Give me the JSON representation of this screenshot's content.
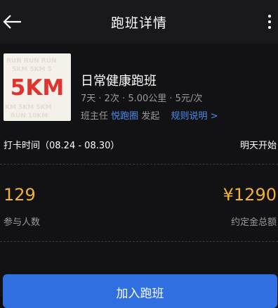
{
  "header": {
    "title": "跑班详情",
    "back_icon": "arrow-left-icon",
    "more_icon": "more-vertical-icon"
  },
  "run": {
    "cover_label": "5KM",
    "cover_color": "#e0322f",
    "title": "日常健康跑班",
    "meta": "7天 · 2次 · 5.00公里 · 5元/次",
    "organizer_prefix": "班主任",
    "organizer_name": "悦跑圈",
    "organizer_suffix": "发起",
    "rules_link": "规则说明 >"
  },
  "checkin": {
    "label": "打卡时间（08.24 - 08.30）",
    "start_text": "明天开始"
  },
  "stats": {
    "participants_value": "129",
    "participants_label": "参与人数",
    "deposit_value": "¥1290",
    "deposit_label": "约定金总额"
  },
  "action": {
    "join_label": "加入跑班"
  },
  "colors": {
    "accent_blue": "#2f6fe1",
    "link_blue": "#4b8ff0",
    "number_gold": "#f2b13a"
  }
}
